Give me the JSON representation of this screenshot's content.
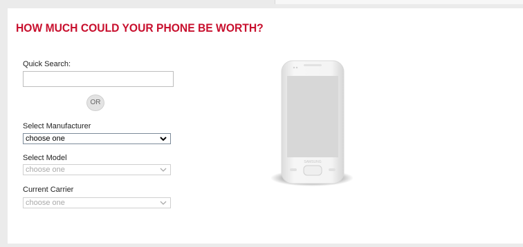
{
  "page": {
    "heading": "HOW MUCH COULD YOUR PHONE BE WORTH?",
    "heading_color": "#c8102e"
  },
  "quick_search": {
    "label": "Quick Search:",
    "value": "",
    "placeholder": ""
  },
  "or_label": "OR",
  "manufacturer": {
    "label": "Select Manufacturer",
    "selected": "choose one"
  },
  "model": {
    "label": "Select Model",
    "selected": "choose one"
  },
  "carrier": {
    "label": "Current Carrier",
    "selected": "choose one"
  },
  "phone_image": {
    "icon": "phone-image",
    "brand_text": "SAMSUNG"
  }
}
